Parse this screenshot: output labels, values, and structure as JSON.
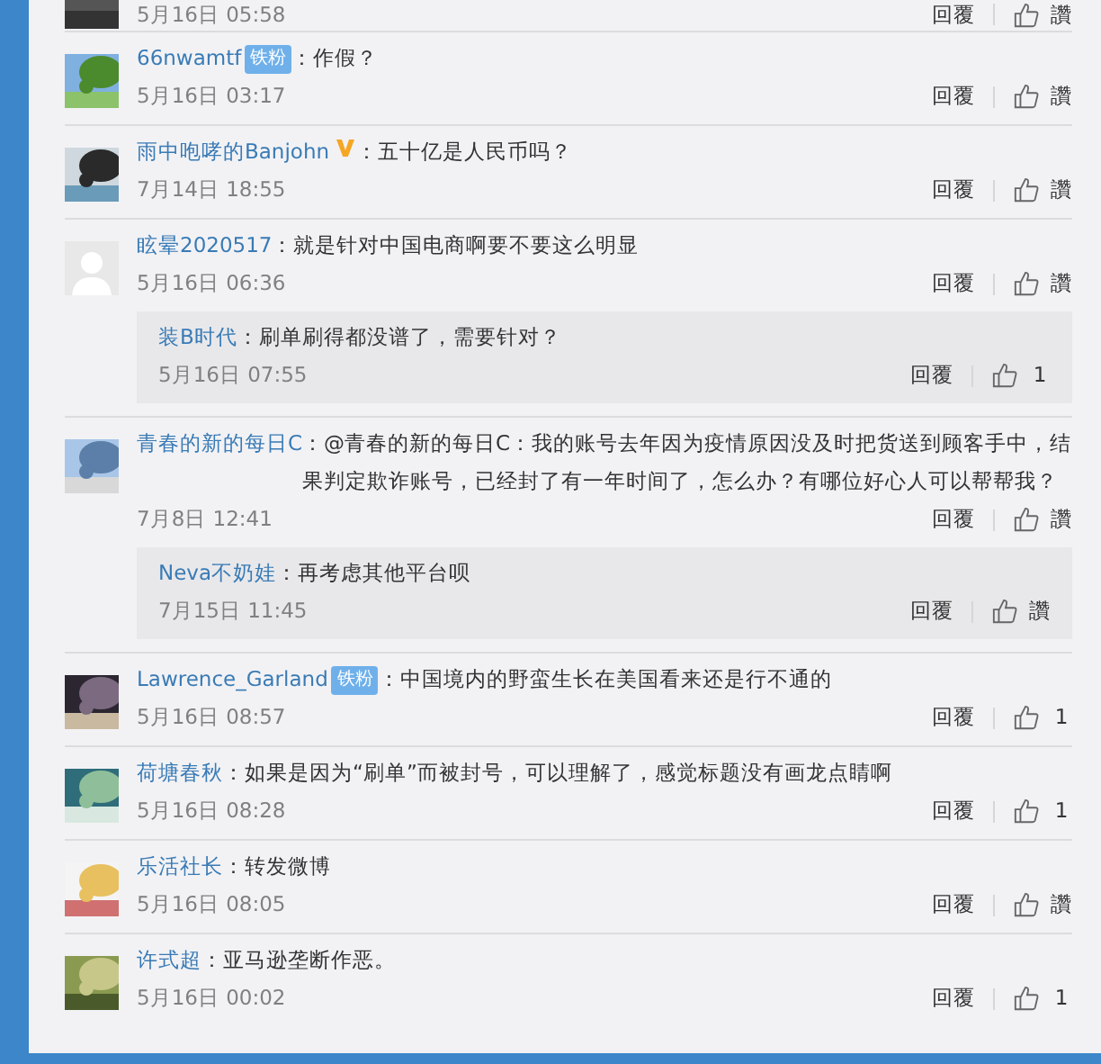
{
  "partial_top": {
    "time": "5月16日 05:58",
    "reply": "回覆",
    "like": "讚"
  },
  "comments": [
    {
      "user": "66nwamtf",
      "badge": "铁粉",
      "verified": false,
      "text": "：作假？",
      "time": "5月16日 03:17",
      "reply": "回覆",
      "like": "讚"
    },
    {
      "user": "雨中咆哮的Banjohn",
      "verified": true,
      "text": "：五十亿是人民币吗？",
      "time": "7月14日 18:55",
      "reply": "回覆",
      "like": "讚"
    },
    {
      "avatar": {
        "kind": "default"
      },
      "user": "眩晕2020517",
      "verified": false,
      "text": "：就是针对中国电商啊要不要这么明显",
      "time": "5月16日 06:36",
      "reply": "回覆",
      "like": "讚",
      "replies": [
        {
          "user": "装B时代",
          "text": "：刷单刷得都没谱了，需要针对？",
          "time": "5月16日 07:55",
          "reply": "回覆",
          "like": "1"
        }
      ]
    },
    {
      "user": "青春的新的每日C",
      "verified": false,
      "text": "：@青春的新的每日C：我的账号去年因为疫情原因没及时把货送到顾客手中，结果判定欺诈账号，已经封了有一年时间了，怎么办？有哪位好心人可以帮帮我？",
      "time": "7月8日 12:41",
      "reply": "回覆",
      "like": "讚",
      "replies": [
        {
          "user": "Neva不奶娃",
          "text": "：再考虑其他平台呗",
          "time": "7月15日 11:45",
          "reply": "回覆",
          "like": "讚"
        }
      ]
    },
    {
      "user": "Lawrence_Garland",
      "badge": "铁粉",
      "verified": false,
      "text": "：中国境内的野蛮生长在美国看来还是行不通的",
      "time": "5月16日 08:57",
      "reply": "回覆",
      "like": "1"
    },
    {
      "user": "荷塘春秋",
      "verified": false,
      "text": "：如果是因为“刷单”而被封号，可以理解了，感觉标题没有画龙点睛啊",
      "time": "5月16日 08:28",
      "reply": "回覆",
      "like": "1"
    },
    {
      "user": "乐活社长",
      "verified": false,
      "text": "：转发微博",
      "time": "5月16日 08:05",
      "reply": "回覆",
      "like": "讚"
    },
    {
      "user": "许式超",
      "verified": false,
      "text": "：亚马逊垄断作恶。",
      "time": "5月16日 00:02",
      "reply": "回覆",
      "like": "1"
    }
  ]
}
